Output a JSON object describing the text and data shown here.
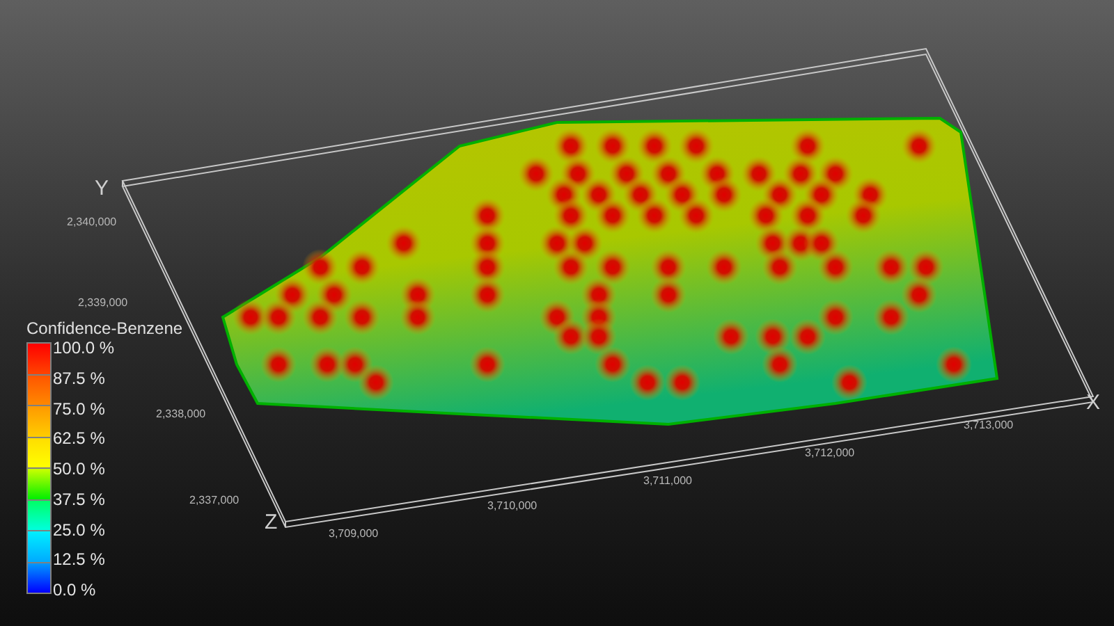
{
  "axes": [
    {
      "letter": "Y",
      "ticks": [
        "2,340,000",
        "2,339,000",
        "2,338,000",
        "2,337,000"
      ]
    },
    {
      "letter": "Z"
    },
    {
      "letter": "X",
      "ticks": [
        "3,709,000",
        "3,710,000",
        "3,711,000",
        "3,712,000",
        "3,713,000"
      ]
    }
  ],
  "legend": {
    "title": "Confidence-Benzene",
    "labels": [
      "100.0 %",
      "87.5 %",
      "75.0 %",
      "62.5 %",
      "50.0 %",
      "37.5 %",
      "25.0 %",
      "12.5 %",
      "0.0 %"
    ]
  }
}
